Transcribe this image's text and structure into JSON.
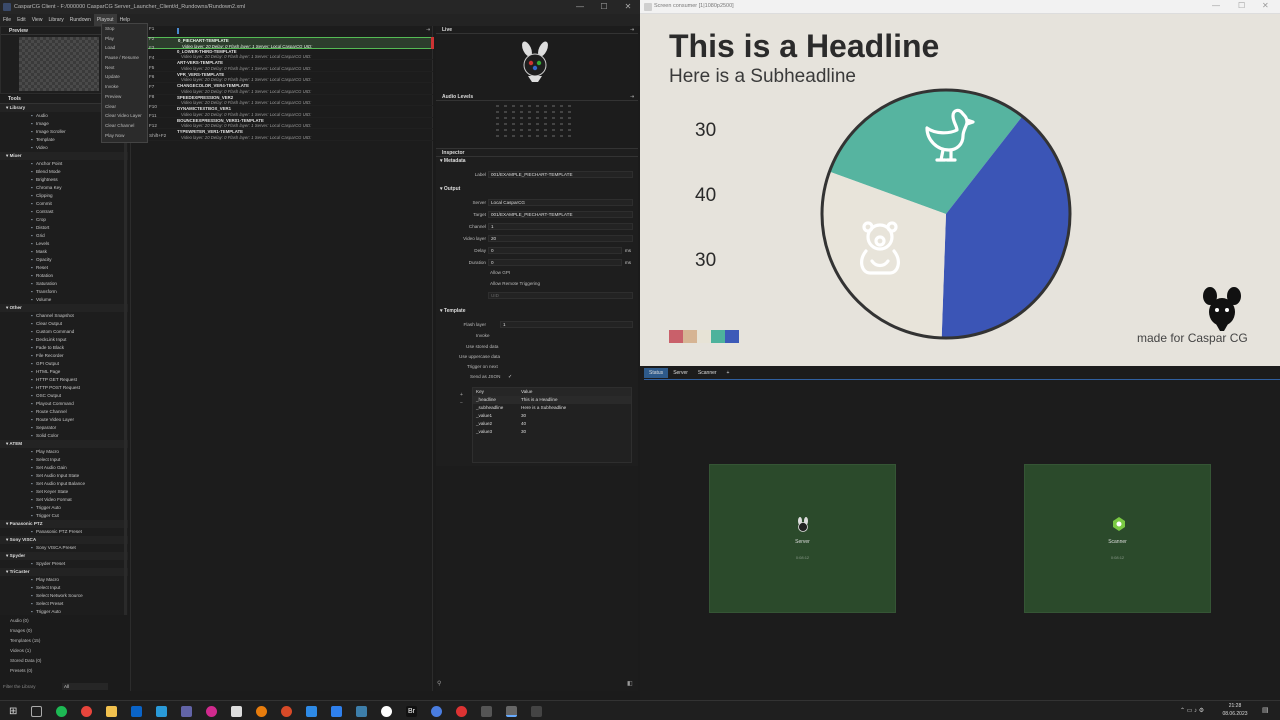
{
  "window": {
    "title": "CasparCG Client - F:/000000 CasparCG Server_Launcher_Client/d_Rundowns/Rundown2.xml",
    "minimize": "—",
    "maximize": "☐",
    "close": "✕"
  },
  "menu": [
    "File",
    "Edit",
    "View",
    "Library",
    "Rundown",
    "Playout",
    "Help"
  ],
  "playout_menu": [
    {
      "label": "Stop",
      "key": "F1"
    },
    {
      "label": "Play",
      "key": "F2"
    },
    {
      "label": "Load",
      "key": "F3"
    },
    {
      "label": "Pause / Resume",
      "key": "F4"
    },
    {
      "label": "Next",
      "key": "F5"
    },
    {
      "label": "Update",
      "key": "F6"
    },
    {
      "label": "Invoke",
      "key": "F7"
    },
    {
      "label": "Preview",
      "key": "F8"
    },
    {
      "label": "Clear",
      "key": "F10"
    },
    {
      "label": "Clear Video Layer",
      "key": "F11"
    },
    {
      "label": "Clear Channel",
      "key": "F12"
    },
    {
      "label": "Play Now",
      "key": "Shift+F2"
    }
  ],
  "preview": {
    "title": "Preview"
  },
  "tools": {
    "title": "Tools",
    "sections": [
      {
        "name": "Library",
        "items": [
          "Audio",
          "Image",
          "Image Scroller",
          "Template",
          "Video"
        ]
      },
      {
        "name": "Mixer",
        "items": [
          "Anchor Point",
          "Blend Mode",
          "Brightness",
          "Chroma Key",
          "Clipping",
          "Commit",
          "Contrast",
          "Crop",
          "Distort",
          "Grid",
          "Levels",
          "Mask",
          "Opacity",
          "Reset",
          "Rotation",
          "Saturation",
          "Transform",
          "Volume"
        ]
      },
      {
        "name": "Other",
        "items": [
          "Channel Snapshot",
          "Clear Output",
          "Custom Command",
          "DeckLink Input",
          "Fade to Black",
          "File Recorder",
          "GPI Output",
          "HTML Page",
          "HTTP GET Request",
          "HTTP POST Request",
          "OSC Output",
          "Playout Command",
          "Route Channel",
          "Route Video Layer",
          "Separator",
          "Solid Color"
        ]
      },
      {
        "name": "ATEM",
        "items": [
          "Play Macro",
          "Select Input",
          "Set Audio Gain",
          "Set Audio Input State",
          "Set Audio Input Balance",
          "Set Keyer State",
          "Set Video Format",
          "Trigger Auto",
          "Trigger Cut"
        ]
      },
      {
        "name": "Panasonic PTZ",
        "items": [
          "Panasonic PTZ Preset"
        ]
      },
      {
        "name": "Sony VISCA",
        "items": [
          "Sony VISCA Preset"
        ]
      },
      {
        "name": "Spyder",
        "items": [
          "Spyder Preset"
        ]
      },
      {
        "name": "TriCaster",
        "items": [
          "Play Macro",
          "Select Input",
          "Select Network Source",
          "Select Preset",
          "Trigger Auto"
        ]
      }
    ]
  },
  "library_counts": [
    "Audio (0)",
    "Images (0)",
    "Templates (15)",
    "Videos (1)",
    "Stored Data (0)",
    "Presets (0)"
  ],
  "filter": {
    "placeholder": "Filter the Library",
    "value": "All"
  },
  "rundown": [
    {
      "name": "0_PIECHART-TEMPLATE",
      "detail": "Video layer: 20    Delay: 0        Flash layer: 1   Server: Local CasparCG                    UID:",
      "active": true
    },
    {
      "name": "0_LOWER-THIRD-TEMPLATE",
      "detail": "Video layer: 20    Delay: 0        Flash layer: 1   Server: Local CasparCG                    UID:",
      "active": false
    },
    {
      "name": "ART-VERS-TEMPLATE",
      "detail": "Video layer: 20    Delay: 0        Flash layer: 1   Server: Local CasparCG                    UID:",
      "active": false
    },
    {
      "name": "VPR_VERS-TEMPLATE",
      "detail": "Video layer: 20    Delay: 0        Flash layer: 1   Server: Local CasparCG                    UID:",
      "active": false
    },
    {
      "name": "CHANGECOLOR_VER4-TEMPLATE",
      "detail": "Video layer: 20    Delay: 0        Flash layer: 1   Server: Local CasparCG                    UID:",
      "active": false
    },
    {
      "name": "SPEEDEXPRESSION_VER2",
      "detail": "Video layer: 20    Delay: 0        Flash layer: 1   Server: Local CasparCG                    UID:",
      "active": false
    },
    {
      "name": "DYNAMICTEXTBOX_VER1",
      "detail": "Video layer: 20    Delay: 0        Flash layer: 1   Server: Local CasparCG                    UID:",
      "active": false
    },
    {
      "name": "BOUNCEEXPRESSION_VER01-TEMPLATE",
      "detail": "Video layer: 20    Delay: 0        Flash layer: 1   Server: Local CasparCG                    UID:",
      "active": false
    },
    {
      "name": "TYPEWRITER_VER1-TEMPLATE",
      "detail": "Video layer: 20    Delay: 0        Flash layer: 1   Server: Local CasparCG                    UID:",
      "active": false
    }
  ],
  "live": {
    "title": "Live"
  },
  "audio_levels": {
    "title": "Audio Levels"
  },
  "inspector": {
    "title": "Inspector",
    "metadata": {
      "title": "Metadata",
      "label_caption": "Label",
      "label_value": "001/EXAMPLE_PIECHART-TEMPLATE"
    },
    "output": {
      "title": "Output",
      "server_caption": "Server",
      "server_value": "Local CasparCG",
      "target_caption": "Target",
      "target_value": "001/EXAMPLE_PIECHART-TEMPLATE",
      "channel_caption": "Channel",
      "channel_value": "1",
      "videolayer_caption": "Video layer",
      "videolayer_value": "20",
      "delay_caption": "Delay",
      "delay_value": "0",
      "delay_unit": "ms",
      "duration_caption": "Duration",
      "duration_value": "0",
      "duration_unit": "ms",
      "allow_gpi": "Allow GPI",
      "allow_remote": "Allow Remote Triggering",
      "uid_caption": "UID"
    },
    "template": {
      "title": "Template",
      "flash_caption": "Flash layer",
      "flash_value": "1",
      "invoke_caption": "Invoke",
      "use_stored": "Use stored data",
      "use_uppercase": "Use uppercase data",
      "trigger_next": "Trigger on next",
      "send_json": "Send as JSON",
      "send_json_check": "✓",
      "kv_header_key": "Key",
      "kv_header_value": "Value",
      "kv": [
        {
          "key": "_headline",
          "value": "This is a Headline"
        },
        {
          "key": "_subheadline",
          "value": "Here is a Subheadline"
        },
        {
          "key": "_value1",
          "value": "30"
        },
        {
          "key": "_value2",
          "value": "40"
        },
        {
          "key": "_value3",
          "value": "30"
        }
      ]
    }
  },
  "screen_consumer": {
    "title": "Screen consumer [1|1080p2500]",
    "headline": "This is a Headline",
    "subheadline": "Here is a Subheadline",
    "values": [
      "30",
      "40",
      "30"
    ],
    "made_for": "made for",
    "brand": "Caspar CG",
    "palette": [
      "#c9606a",
      "#d6b493",
      "#e7e3d6",
      "#4db29c",
      "#3d5ab8"
    ]
  },
  "chart_data": {
    "type": "pie",
    "values": [
      30,
      40,
      30
    ],
    "colors": [
      "#56b4a0",
      "#3b55b6",
      "#e8e4da"
    ]
  },
  "monitor": {
    "tabs": [
      "Status",
      "Server",
      "Scanner"
    ],
    "add_tab": "+",
    "tiles": [
      {
        "label": "Server",
        "time": "0:08:12"
      },
      {
        "label": "Scanner",
        "time": "0:08:12"
      }
    ]
  },
  "taskbar": {
    "time": "21:28",
    "date": "08.06.2023"
  }
}
